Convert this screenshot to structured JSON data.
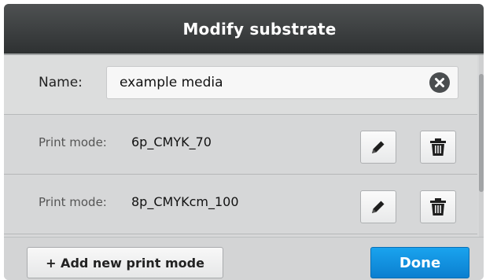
{
  "dialog": {
    "title": "Modify substrate"
  },
  "name_field": {
    "label": "Name:",
    "value": "example media",
    "clear_icon": "clear-circle-x-icon"
  },
  "print_modes": [
    {
      "label": "Print mode:",
      "value": "6p_CMYK_70",
      "edit_icon": "pencil-icon",
      "delete_icon": "trash-icon"
    },
    {
      "label": "Print mode:",
      "value": "8p_CMYKcm_100",
      "edit_icon": "pencil-icon",
      "delete_icon": "trash-icon"
    }
  ],
  "footer": {
    "add_label": "+ Add new print mode",
    "done_label": "Done"
  },
  "colors": {
    "title_bar": "#3a3d3e",
    "accent_done": "#1291e0",
    "panel": "#d7d8d9"
  }
}
